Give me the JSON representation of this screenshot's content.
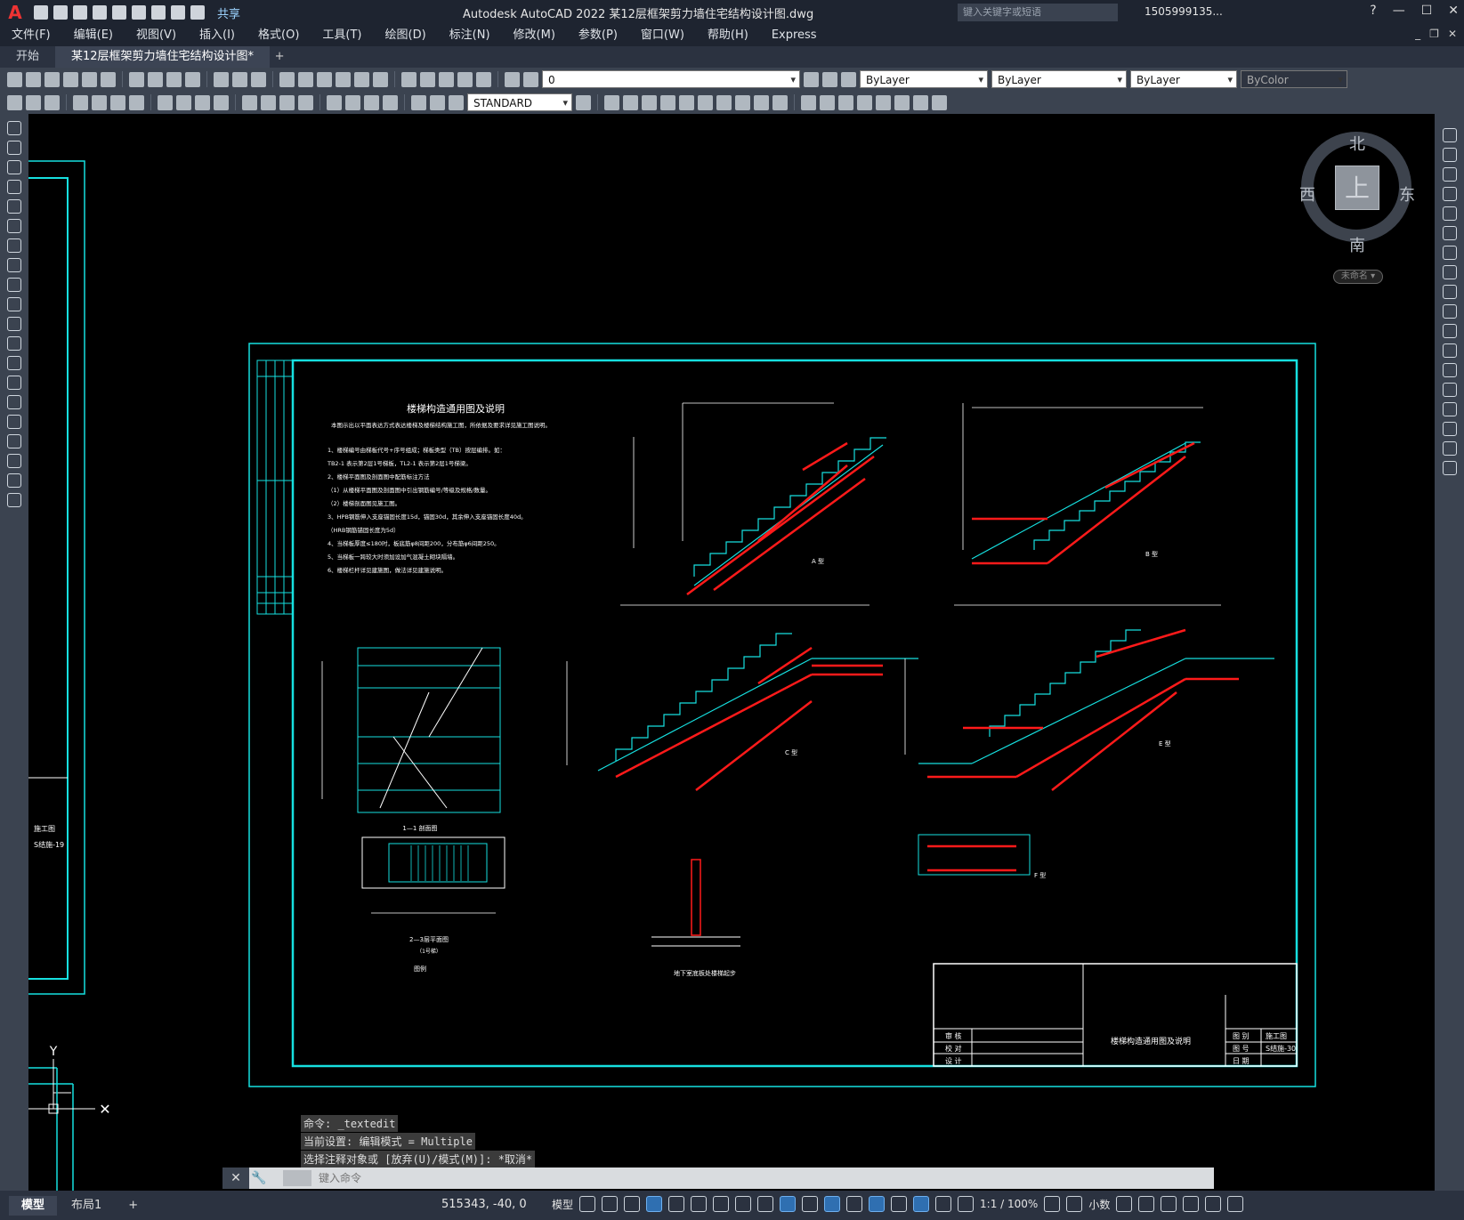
{
  "app": {
    "logo": "A",
    "title": "Autodesk AutoCAD 2022    某12层框架剪力墙住宅结构设计图.dwg",
    "share": "共享",
    "search_placeholder": "键入关键字或短语",
    "user": "1505999135...",
    "win_min": "—",
    "win_max": "☐",
    "win_close": "✕",
    "help": "?"
  },
  "menu": [
    "文件(F)",
    "编辑(E)",
    "视图(V)",
    "插入(I)",
    "格式(O)",
    "工具(T)",
    "绘图(D)",
    "标注(N)",
    "修改(M)",
    "参数(P)",
    "窗口(W)",
    "帮助(H)",
    "Express"
  ],
  "tabs": [
    {
      "label": "开始",
      "active": false
    },
    {
      "label": "某12层框架剪力墙住宅结构设计图*",
      "active": true
    }
  ],
  "tab_add": "+",
  "layer": {
    "current": "0",
    "color": "ByLayer",
    "linetype": "ByLayer",
    "lineweight": "ByLayer",
    "plotstyle": "ByColor"
  },
  "textstyle": "STANDARD",
  "viewcube": {
    "north": "北",
    "south": "南",
    "east": "东",
    "west": "西",
    "face": "上",
    "ucs_name": "未命名 ▾"
  },
  "command": {
    "history": [
      "命令: _textedit",
      "当前设置: 编辑模式 = Multiple",
      "选择注释对象或 [放弃(U)/模式(M)]: *取消*"
    ],
    "placeholder": "键入命令",
    "close": "✕"
  },
  "status": {
    "tabs": [
      {
        "label": "模型",
        "active": true
      },
      {
        "label": "布局1",
        "active": false
      }
    ],
    "add": "+",
    "coords": "515343, -40, 0",
    "model": "模型",
    "scale": "1:1 / 100%",
    "units": "小数"
  },
  "drawing": {
    "sheet_title": "楼梯构造通用图及说明",
    "notes_intro": "本图示出以平面表达方式表达楼梯及楼梯结构施工图，所依据及要求详见施工图说明。",
    "notes": [
      "1、楼梯编号由梯板代号+序号组成；梯板类型（TB）按层编排。如：",
      "TB2-1 表示第2层1号梯板，TL2-1 表示第2层1号梯梁。",
      "2、楼梯平面图及剖面图中配筋标注方法",
      "（1）从楼梯平面图及剖面图中引出钢筋编号/等级及规格/数量。",
      "（2）楼梯剖面图见施工图。",
      "3、HPB钢筋伸入支座锚固长度15d，锚固30d，其余伸入支座锚固长度40d。",
      "（HRB钢筋锚固长度为5d）",
      "4、当梯板厚度≤180时，板底筋φ8间距200，分布筋φ6间距250。",
      "5、当梯板一跨较大时须加设加气混凝土砌块隔墙。",
      "6、楼梯栏杆详见建施图，做法详见建施说明。"
    ],
    "stair_labels": [
      "A 型",
      "B 型",
      "C 型",
      "E 型",
      "F 型"
    ],
    "section_1_1": "1—1 剖面图",
    "plan_2_3": "2—3层平面图",
    "plan_note": "（1号梯）",
    "legend": "图例",
    "basement": "地下室底板处楼梯起步",
    "titleblock": {
      "rows_left": [
        "审 核",
        "校 对",
        "设 计"
      ],
      "project": "楼梯构造通用图及说明",
      "rows_right_labels": [
        "图 别",
        "图 号",
        "日 期"
      ],
      "rows_right_values": [
        "施工图",
        "S结施-30",
        ""
      ]
    },
    "left_sheet": {
      "label1": "施工图",
      "label2": "S结施-19"
    }
  },
  "colors": {
    "cyan": "#16e0e0",
    "red": "#ff1a1a",
    "white": "#ffffff",
    "green": "#7cff3a",
    "yellow": "#f3f300"
  }
}
